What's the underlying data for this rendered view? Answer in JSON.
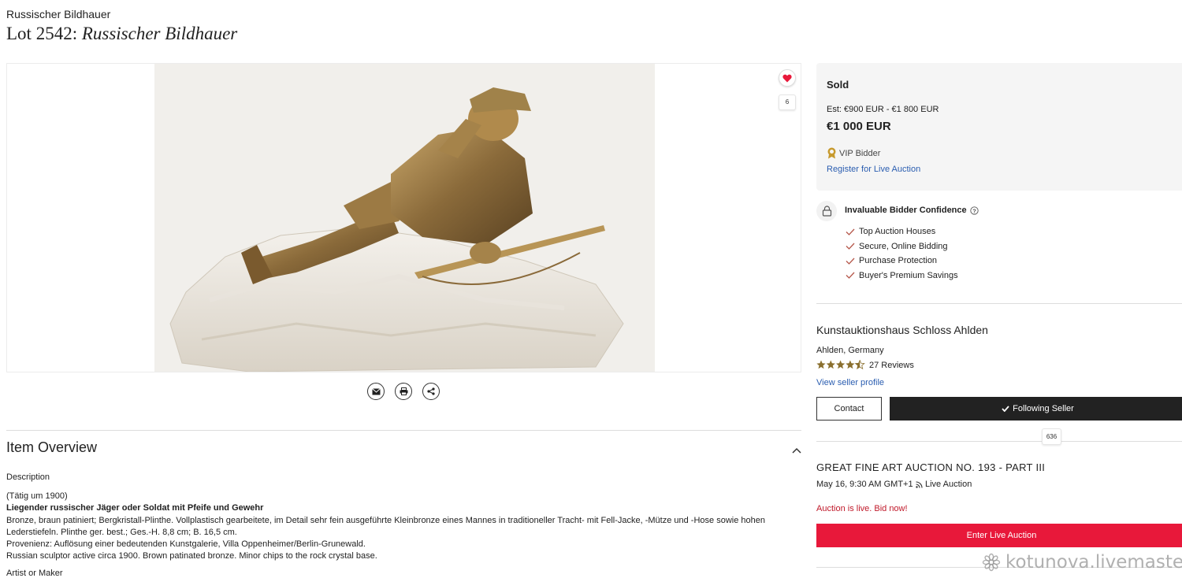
{
  "header": {
    "artist_link": "Russischer Bildhauer",
    "lot_prefix": "Lot 2542:",
    "lot_name": "Russischer Bildhauer"
  },
  "image_panel": {
    "favorite_count": "6",
    "accent_color": "#e8183a"
  },
  "item_overview": {
    "title": "Item Overview",
    "description_label": "Description",
    "line1": "(Tätig um 1900)",
    "line2_bold": "Liegender russischer Jäger oder Soldat mit Pfeife und Gewehr",
    "line3": "Bronze, braun patiniert; Bergkristall-Plinthe. Vollplastisch gearbeitete, im Detail sehr fein ausgeführte Kleinbronze eines Mannes in traditioneller Tracht- mit Fell-Jacke, -Mütze und -Hose sowie hohen Lederstiefeln. Plinthe ger. best.; Ges.-H. 8,8 cm; B. 16,5 cm.",
    "line4": "Provenienz: Auflösung einer bedeutenden Kunstgalerie, Villa Oppenheimer/Berlin-Grunewald.",
    "line5": "Russian sculptor active circa 1900. Brown patinated bronze. Minor chips to the rock crystal base.",
    "artist_label": "Artist or Maker"
  },
  "sale": {
    "status": "Sold",
    "estimate": "Est: €900 EUR - €1 800 EUR",
    "price": "€1 000 EUR",
    "vip_label": "VIP Bidder",
    "register_link": "Register for Live Auction"
  },
  "confidence": {
    "title": "Invaluable Bidder Confidence",
    "items": [
      "Top Auction Houses",
      "Secure, Online Bidding",
      "Purchase Protection",
      "Buyer's Premium Savings"
    ]
  },
  "seller": {
    "name": "Kunstauktionshaus Schloss Ahlden",
    "location": "Ahlden, Germany",
    "rating": 4.5,
    "reviews": "27 Reviews",
    "view_profile": "View seller profile",
    "contact_label": "Contact",
    "follow_label": "Following Seller",
    "follow_count": "636"
  },
  "auction": {
    "title": "GREAT FINE ART AUCTION NO. 193 - PART III",
    "date": "May 16, 9:30 AM GMT+1",
    "type": "Live Auction",
    "live_notice": "Auction is live. Bid now!",
    "enter_label": "Enter Live Auction"
  },
  "watermark": {
    "text": "kotunova.livemaster.ru"
  }
}
